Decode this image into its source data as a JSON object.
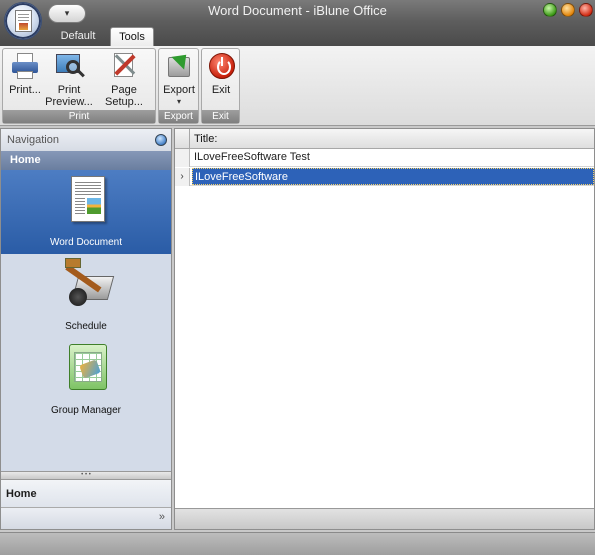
{
  "window": {
    "title": "Word Document - iBlune Office",
    "qat_icon": "dropdown-arrow-icon",
    "controls": [
      "maximize-icon",
      "minimize-icon",
      "close-icon"
    ]
  },
  "tabs": [
    "Default",
    "Tools"
  ],
  "active_tab": "Tools",
  "ribbon": {
    "groups": [
      {
        "caption": "Print",
        "buttons": [
          {
            "label": "Print...",
            "icon": "printer-icon"
          },
          {
            "label_line1": "Print",
            "label_line2": "Preview...",
            "icon": "print-preview-icon"
          },
          {
            "label": "Page Setup...",
            "icon": "page-setup-icon"
          }
        ]
      },
      {
        "caption": "Export",
        "buttons": [
          {
            "label": "Export",
            "icon": "export-icon",
            "caret": "▾"
          }
        ]
      },
      {
        "caption": "Exit",
        "buttons": [
          {
            "label": "Exit",
            "icon": "exit-icon"
          }
        ]
      }
    ]
  },
  "navigation": {
    "header": "Navigation",
    "section": "Home",
    "items": [
      {
        "label": "Word Document",
        "icon": "word-document-icon",
        "active": true
      },
      {
        "label": "Schedule",
        "icon": "schedule-icon",
        "active": false
      },
      {
        "label": "Group Manager",
        "icon": "group-manager-icon",
        "active": false
      }
    ],
    "bottom_label": "Home",
    "footer_more": "»"
  },
  "grid": {
    "column_header": "Title:",
    "rows": [
      {
        "title": "ILoveFreeSoftware Test",
        "selected": false
      },
      {
        "title": "ILoveFreeSoftware",
        "selected": true,
        "indicator": "›"
      }
    ]
  },
  "colors": {
    "accent_blue": "#2d62b8",
    "nav_active": "#2a5ca6",
    "nav_section": "#6a7e9f"
  }
}
